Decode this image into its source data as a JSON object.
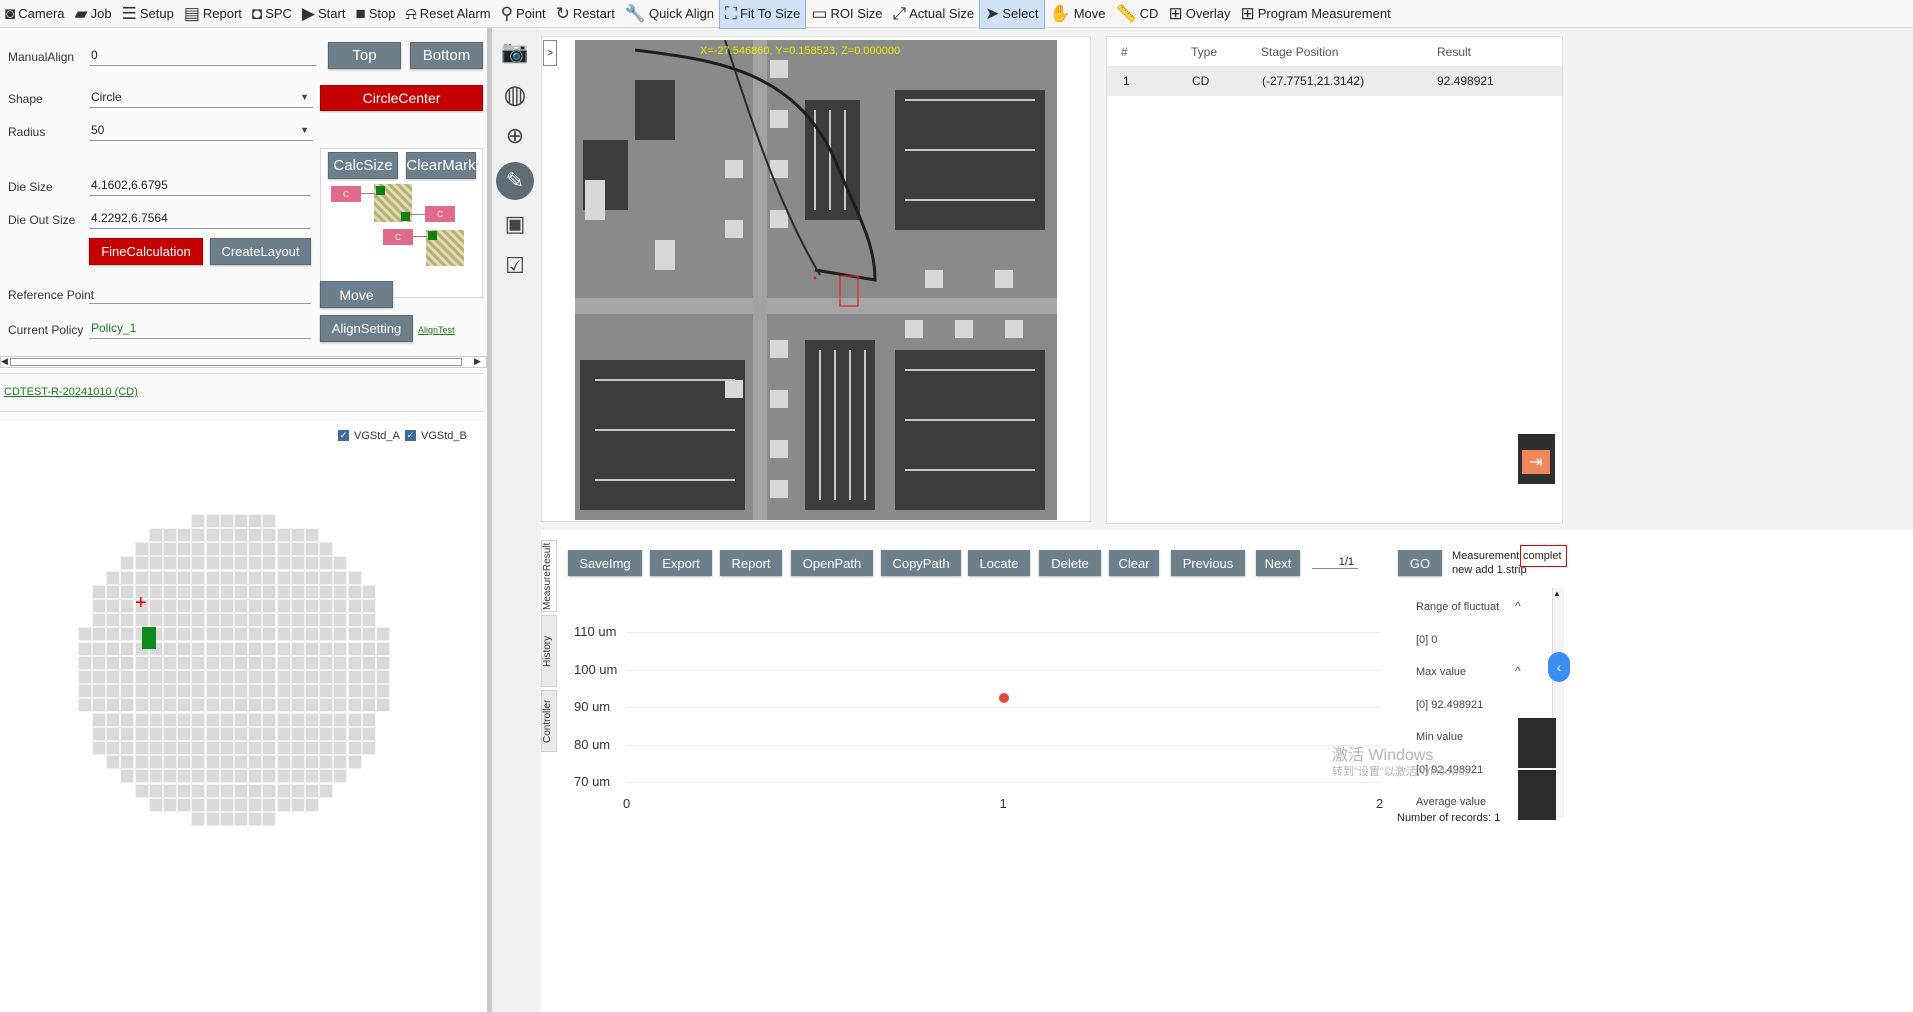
{
  "toolbar": {
    "items": [
      {
        "label": "Camera",
        "icon": "camera-icon"
      },
      {
        "label": "Job",
        "icon": "briefcase-icon"
      },
      {
        "label": "Setup",
        "icon": "checklist-icon"
      },
      {
        "label": "Report",
        "icon": "report-icon"
      },
      {
        "label": "SPC",
        "icon": "spc-icon"
      },
      {
        "label": "Start",
        "icon": "play-icon"
      },
      {
        "label": "Stop",
        "icon": "stop-icon"
      },
      {
        "label": "Reset Alarm",
        "icon": "alarm-icon"
      },
      {
        "label": "Point",
        "icon": "pin-icon"
      },
      {
        "label": "Restart",
        "icon": "restart-icon"
      },
      {
        "label": "Quick Align",
        "icon": "wrench-icon"
      },
      {
        "label": "Fit To Size",
        "icon": "fit-icon"
      },
      {
        "label": "ROI Size",
        "icon": "roi-icon"
      },
      {
        "label": "Actual Size",
        "icon": "expand-icon"
      },
      {
        "label": "Select",
        "icon": "cursor-icon"
      },
      {
        "label": "Move",
        "icon": "hand-icon"
      },
      {
        "label": "CD",
        "icon": "ruler-icon"
      },
      {
        "label": "Overlay",
        "icon": "plus-icon"
      },
      {
        "label": "Program Measurement",
        "icon": "plus-icon"
      }
    ]
  },
  "left": {
    "manual_align_label": "ManualAlign",
    "manual_align_value": "0",
    "top_btn": "Top",
    "bottom_btn": "Bottom",
    "shape_label": "Shape",
    "shape_value": "Circle",
    "circle_center_btn": "CircleCenter",
    "radius_label": "Radius",
    "radius_value": "50",
    "calc_size_btn": "CalcSize",
    "clear_mark_btn": "ClearMark",
    "die_size_label": "Die Size",
    "die_size_value": "4.1602,6.6795",
    "die_out_size_label": "Die Out Size",
    "die_out_size_value": "4.2292,6.7564",
    "fine_calc_btn": "FineCalculation",
    "create_layout_btn": "CreateLayout",
    "c_label": "C",
    "ref_point_label": "Reference Point",
    "ref_point_value": "",
    "move_btn": "Move",
    "policy_label": "Current Policy",
    "policy_value": "Policy_1",
    "align_setting_btn": "AlignSetting",
    "align_test_link": "AlignTest",
    "recipe_link": "CDTEST-R-20241010 (CD)",
    "vg_a": "VGStd_A",
    "vg_b": "VGStd_B"
  },
  "image": {
    "coords": "X=-27.546860, Y=0.158523, Z=0.000000",
    "expand": ">"
  },
  "results": {
    "headers": [
      "#",
      "Type",
      "Stage Position",
      "Result"
    ],
    "rows": [
      {
        "n": "1",
        "type": "CD",
        "pos": "(-27.7751,21.3142)",
        "result": "92.498921"
      }
    ]
  },
  "bottom": {
    "tabs": [
      "MeasureResult",
      "History",
      "Controller"
    ],
    "buttons": [
      "SaveImg",
      "Export",
      "Report",
      "OpenPath",
      "CopyPath",
      "Locate",
      "Delete",
      "Clear",
      "Previous",
      "Next"
    ],
    "page": "1/1",
    "go": "GO",
    "status_1": "Measurement",
    "status_highlight": "complet",
    "status_2": "new add 1.strip",
    "records": "Number of records: 1",
    "side": {
      "range_label": "Range of fluctuat",
      "range_value": "[0]   0",
      "max_label": "Max value",
      "max_value": "[0]   92.498921",
      "min_label": "Min value",
      "min_value": "[0]   92.498921",
      "avg_label": "Average value"
    },
    "watermark_1": "激活 Windows",
    "watermark_2": "转到\"设置\"以激活 Windows。"
  },
  "chart_data": {
    "type": "scatter",
    "x": [
      1
    ],
    "y": [
      92.5
    ],
    "ylim": [
      65,
      115
    ],
    "xlim": [
      0,
      2
    ],
    "yticks": [
      "110 um",
      "100 um",
      "90 um",
      "80 um",
      "70 um"
    ],
    "xticks": [
      "0",
      "1",
      "2"
    ],
    "color": "#e04a3a"
  }
}
